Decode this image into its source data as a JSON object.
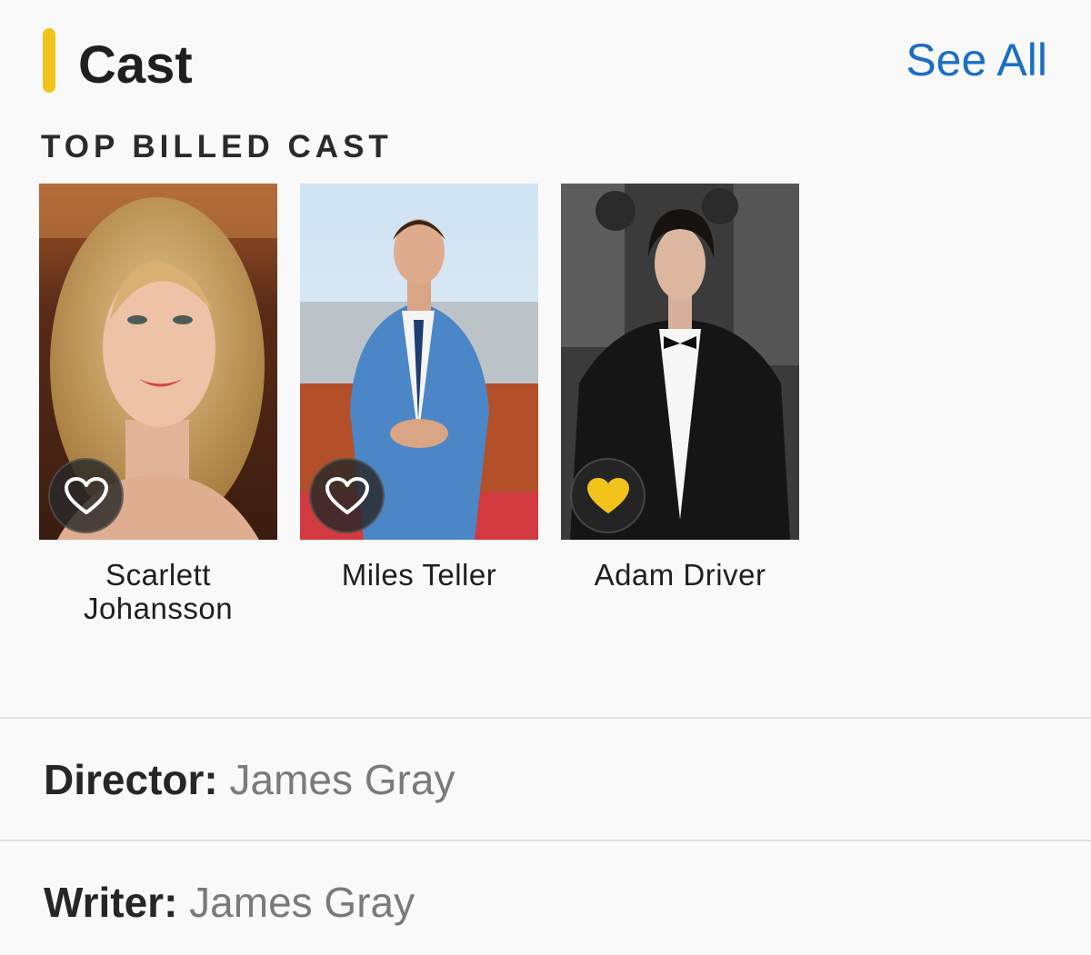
{
  "header": {
    "title": "Cast",
    "see_all_label": "See All",
    "accent_color": "#f2c31a",
    "link_color": "#1a6fc4"
  },
  "subheading": "TOP BILLED CAST",
  "cast": [
    {
      "name_line1": "Scarlett",
      "name_line2": "Johansson",
      "favorited": false,
      "photo_icon": "portrait-photo"
    },
    {
      "name_line1": "Miles Teller",
      "name_line2": "",
      "favorited": false,
      "photo_icon": "portrait-photo"
    },
    {
      "name_line1": "Adam Driver",
      "name_line2": "",
      "favorited": true,
      "photo_icon": "portrait-photo"
    }
  ],
  "credits": {
    "director_label": "Director:",
    "director_value": "James Gray",
    "writer_label": "Writer:",
    "writer_value": "James Gray"
  },
  "icons": {
    "favorite_outline": "heart-outline-icon",
    "favorite_filled": "heart-filled-icon",
    "favorite_filled_color": "#f2c31a"
  }
}
